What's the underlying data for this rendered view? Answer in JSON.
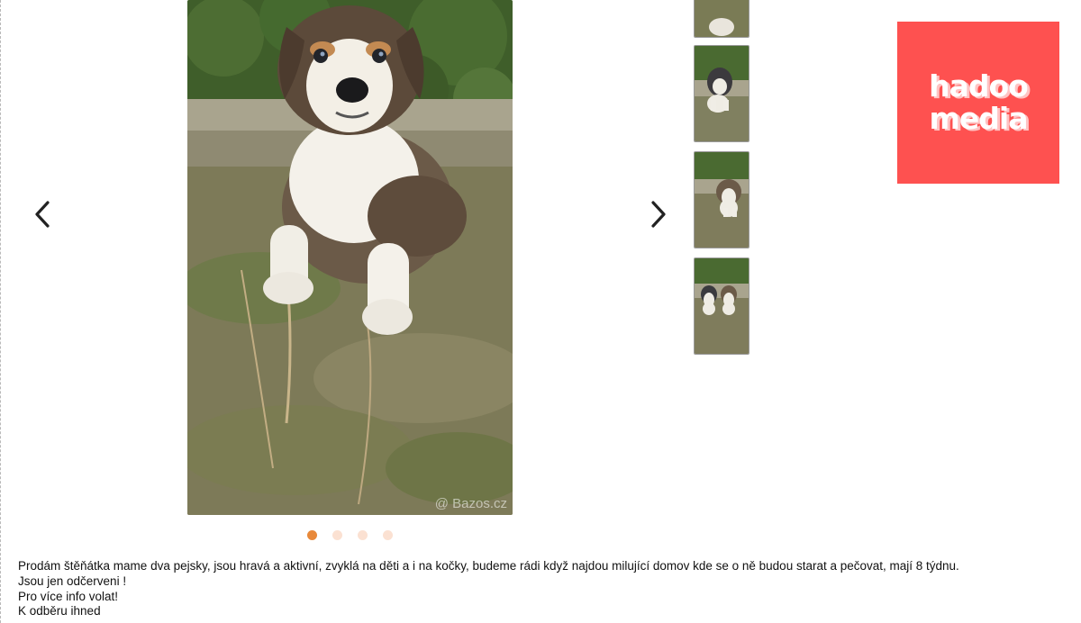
{
  "gallery": {
    "watermark": "@ Bazos.cz",
    "prev_icon": "chevron-left-icon",
    "next_icon": "chevron-right-icon",
    "active_index": 0,
    "dot_count": 4,
    "colors": {
      "dot_active": "#e8893a",
      "dot_inactive": "#fbe1d2"
    }
  },
  "ad": {
    "line1": "hadoo",
    "line2": "media",
    "background": "#fe5150"
  },
  "description": {
    "lines": [
      "Prodám štěňátka mame dva pejsky, jsou hravá a aktivní, zvyklá na děti a i na kočky, budeme rádi když najdou milující domov kde se o ně budou starat a pečovat, mají 8 týdnu.",
      "Jsou jen odčerveni !",
      "Pro více info volat!",
      "K odběru ihned"
    ]
  }
}
